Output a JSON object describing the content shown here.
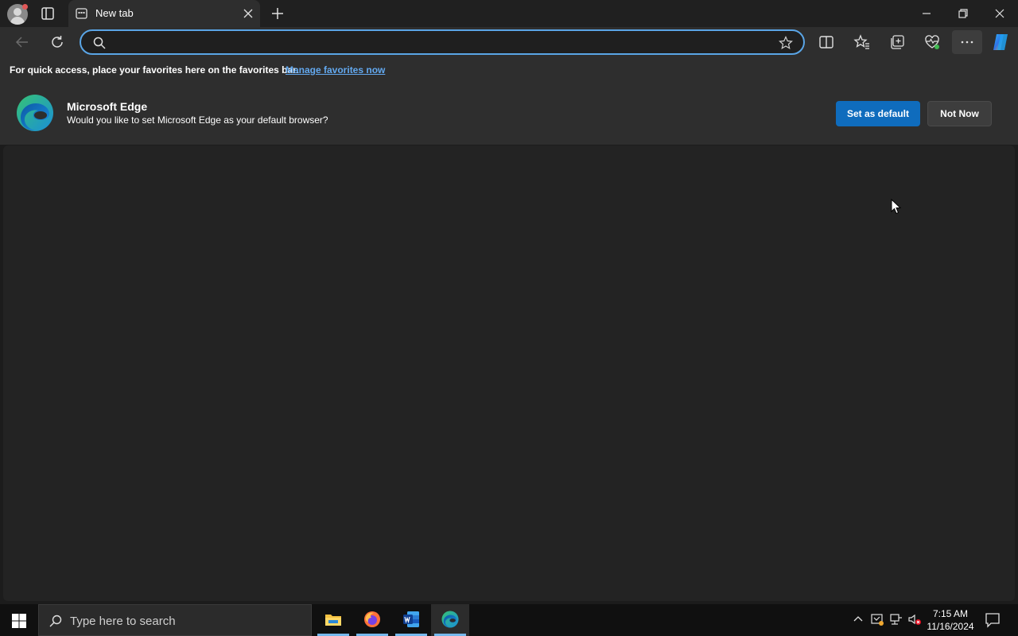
{
  "tab": {
    "title": "New tab"
  },
  "address": {
    "value": "",
    "placeholder": ""
  },
  "favorites_bar": {
    "message": "For quick access, place your favorites here on the favorites bar.",
    "link": "Manage favorites now"
  },
  "banner": {
    "title": "Microsoft Edge",
    "description": "Would you like to set Microsoft Edge as your default browser?",
    "primary_button": "Set as default",
    "secondary_button": "Not Now"
  },
  "taskbar": {
    "search_placeholder": "Type here to search",
    "apps": [
      "file-explorer",
      "firefox",
      "word",
      "edge"
    ],
    "time": "7:15 AM",
    "date": "11/16/2024"
  },
  "colors": {
    "accent": "#0f6cbd",
    "link": "#63a9f0",
    "address_border": "#5aa5e6",
    "taskbar_indicator": "#76b9ed"
  }
}
